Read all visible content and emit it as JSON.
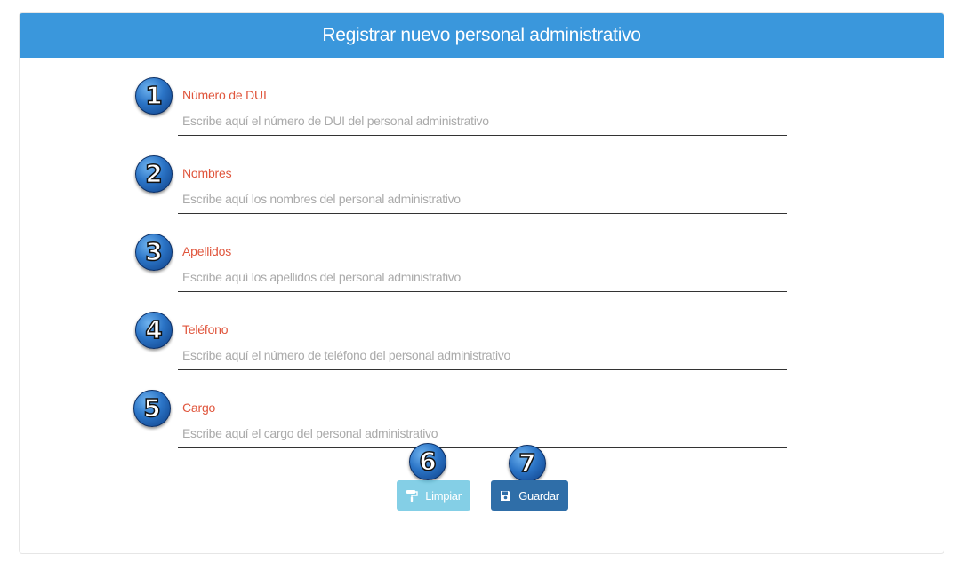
{
  "header": {
    "title": "Registrar nuevo personal administrativo"
  },
  "fields": [
    {
      "number": "1",
      "label": "Número de DUI",
      "placeholder": "Escribe aquí el número de DUI del personal administrativo",
      "value": ""
    },
    {
      "number": "2",
      "label": "Nombres",
      "placeholder": "Escribe aquí los nombres del personal administrativo",
      "value": ""
    },
    {
      "number": "3",
      "label": "Apellidos",
      "placeholder": "Escribe aquí los apellidos del personal administrativo",
      "value": ""
    },
    {
      "number": "4",
      "label": "Teléfono",
      "placeholder": "Escribe aquí el número de teléfono del personal administrativo",
      "value": ""
    },
    {
      "number": "5",
      "label": "Cargo",
      "placeholder": "Escribe aquí el cargo del personal administrativo",
      "value": ""
    }
  ],
  "buttons": {
    "clear": {
      "number": "6",
      "label": "Limpiar",
      "icon": "paint-roller-icon"
    },
    "save": {
      "number": "7",
      "label": "Guardar",
      "icon": "floppy-disk-icon"
    }
  },
  "colors": {
    "header_bg": "#3a97dc",
    "label": "#e0563d",
    "clear_button": "#5bc0de",
    "save_button": "#2f6ea8",
    "badge": "#2b74c6"
  }
}
